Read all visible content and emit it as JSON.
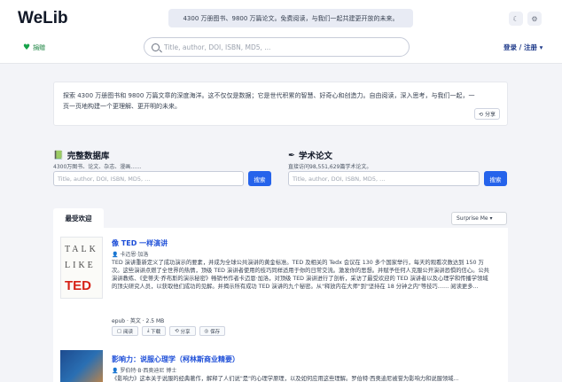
{
  "header": {
    "logo": "WeLib",
    "banner": "4300 万册图书、9800 万篇论文。免费阅读，与我们一起共建更开放的未来。",
    "donate_label": "捐赠",
    "search_placeholder": "Title, author, DOI, ISBN, MD5, ...",
    "login_label": "登录 / 注册 ▾"
  },
  "intro": {
    "text": "探索 4300 万册图书和 9800 万篇文章的深度海洋。这不仅仅是数据；它是世代积累的智慧、好奇心和创造力。自由阅读，深入思考，与我们一起，一页一页地构建一个更理解、更开明的未来。",
    "share_label": "分享"
  },
  "books_db": {
    "title": "完整数据库",
    "subtitle": "4300万图书、论文、杂志、漫画……",
    "placeholder": "Title, author, DOI, ISBN, MD5, ...",
    "button": "搜索"
  },
  "papers_db": {
    "title": "学术论文",
    "subtitle": "直接访问98,551,629篇学术论文。",
    "placeholder": "Title, author, DOI, ISBN, MD5, ...",
    "button": "搜索"
  },
  "list": {
    "tab_label": "最受欢迎",
    "sort_label": "Surprise Me"
  },
  "books": [
    {
      "cover_lines": [
        "TALK",
        "LIKE",
        "TED"
      ],
      "title": "像 TED 一样演讲",
      "author": "卡迈恩·加洛",
      "desc": "TED 演讲重新定义了成功演示的要素，并成为全球公共演讲的黄金标准。TED 及相关的 Tedx 会议在 130 多个国家举行，每天的观看次数达到 150 万次。这些演讲点燃了全世界的热情，顶级 TED 演讲者使用的技巧同样适用于你的日常交流。激发你的思想。并赋予任何人克服公开演讲恐惧的信心。公共演讲教练、《史蒂夫·乔布斯的演示秘密》畅销书作者卡迈恩·加洛，对顶级 TED 演讲进行了剖析，采访了最受欢迎的 TED 演讲者以及心理学和传播学领域的顶尖研究人员，以获取他们成功的见解。并揭示所有成功 TED 演讲的九个秘密。从\"释放内在大师\"到\"坚持在 18 分钟之内\"等技巧…… 阅读更多...",
      "meta": "epub · 英文 · 2.5 MB",
      "actions": [
        "阅读",
        "下载",
        "分享",
        "保存"
      ]
    },
    {
      "title": "影响力：说服心理学（柯林斯商业精要）",
      "author": "罗伯特·B·西奥迪尼 博士",
      "desc": "《影响力》这本关于说服的经典著作，解释了人们说\"是\"的心理学原理，以及如何应用这些理解。罗伯特·西奥迪尼被誉为影响力和说服领域..."
    }
  ]
}
